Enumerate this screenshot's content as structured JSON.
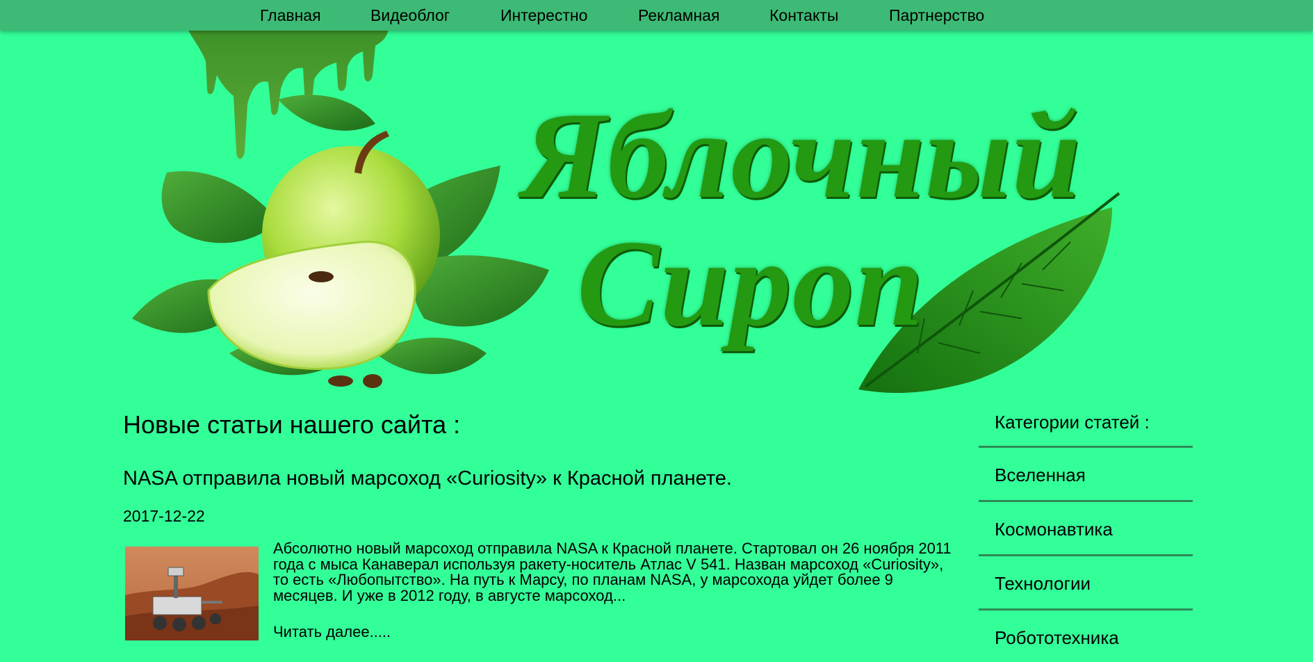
{
  "nav": {
    "items": [
      "Главная",
      "Видеоблог",
      "Интерестно",
      "Рекламная",
      "Контакты",
      "Партнерство"
    ]
  },
  "header": {
    "logo_line1": "Яблочный",
    "logo_line2": "Сироп"
  },
  "main": {
    "section_title": "Новые статьи нашего сайта :",
    "article": {
      "title": "NASA отправила новый марсоход «Curiosity» к Красной планете.",
      "date": "2017-12-22",
      "excerpt": "Абсолютно новый марсоход отправила NASA к Красной планете. Стартовал он 26 ноября 2011 года с мыса Канаверал используя ракету-носитель Атлас V 541. Назван марсоход «Curiosity», то есть «Любопытство». На путь к Марсу, по планам NASA, у марсохода уйдет более 9 месяцев. И уже в 2012 году, в августе марсоход...",
      "read_more": "Читать далее....."
    }
  },
  "sidebar": {
    "title": "Категории статей :",
    "categories": [
      "Вселенная",
      "Космонавтика",
      "Технологии",
      "Робототехника"
    ]
  },
  "colors": {
    "background": "#33ff99",
    "nav_bar": "#3dba75",
    "logo_green": "#239a12",
    "divider": "#2b8a55"
  }
}
